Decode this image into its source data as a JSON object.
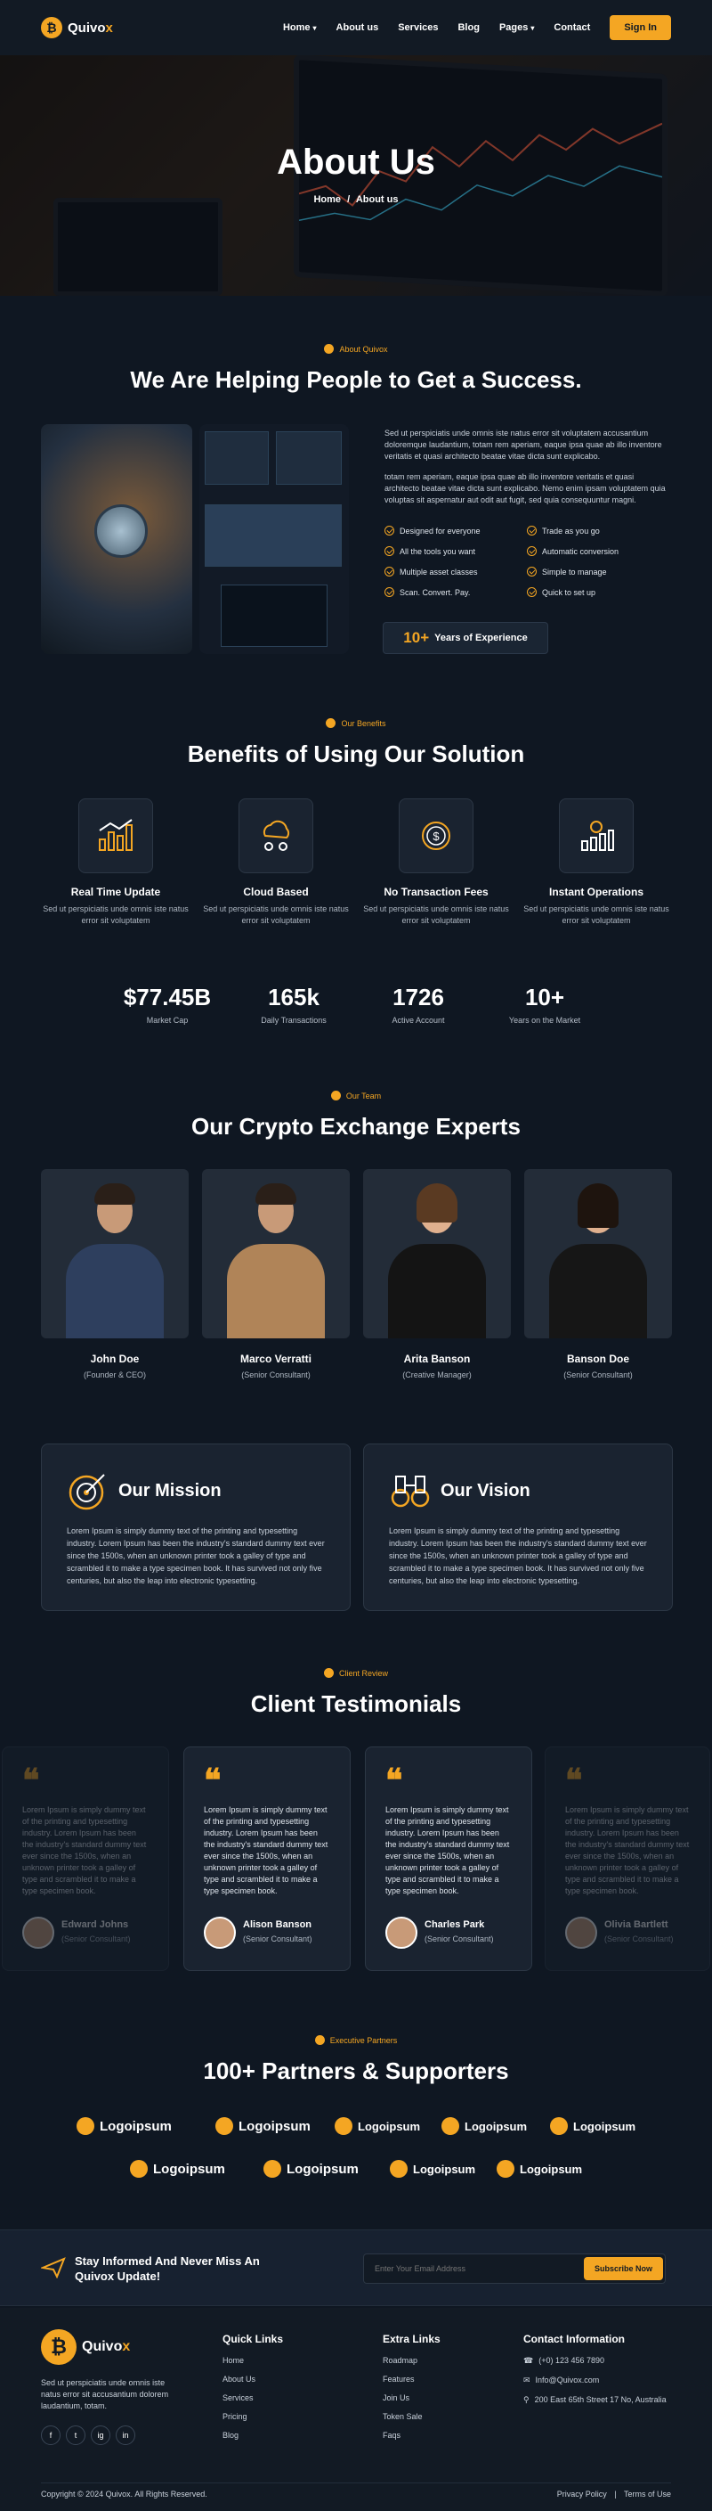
{
  "nav": {
    "brand_prefix": "Quivo",
    "brand_accent": "x",
    "logo_letter": "₿",
    "items": [
      "Home",
      "About us",
      "Services",
      "Blog",
      "Pages",
      "Contact"
    ],
    "signin": "Sign In"
  },
  "hero": {
    "title": "About Us",
    "crumb_home": "Home",
    "crumb_sep": "/",
    "crumb_current": "About us"
  },
  "about": {
    "tag": "About Quivox",
    "title": "We Are Helping People to Get a Success.",
    "para1": "Sed ut perspiciatis unde omnis iste natus error sit voluptatem accusantium doloremque laudantium, totam rem aperiam, eaque ipsa quae ab illo inventore veritatis et quasi architecto beatae vitae dicta sunt explicabo.",
    "para2": "totam rem aperiam, eaque ipsa quae ab illo inventore veritatis et quasi architecto beatae vitae dicta sunt explicabo. Nemo enim ipsam voluptatem quia voluptas sit aspernatur aut odit aut fugit, sed quia consequuntur magni.",
    "checks": [
      "Designed for everyone",
      "Trade as you go",
      "All the tools you want",
      "Automatic conversion",
      "Multiple asset classes",
      "Simple to manage",
      "Scan. Convert. Pay.",
      "Quick to set up"
    ],
    "exp_number": "10+",
    "exp_label": "Years of Experience"
  },
  "benefits": {
    "tag": "Our Benefits",
    "title": "Benefits of Using Our Solution",
    "items": [
      {
        "title": "Real Time Update",
        "desc": "Sed ut perspiciatis unde omnis iste natus error sit voluptatem"
      },
      {
        "title": "Cloud Based",
        "desc": "Sed ut perspiciatis unde omnis iste natus error sit voluptatem"
      },
      {
        "title": "No Transaction Fees",
        "desc": "Sed ut perspiciatis unde omnis iste natus error sit voluptatem"
      },
      {
        "title": "Instant Operations",
        "desc": "Sed ut perspiciatis unde omnis iste natus error sit voluptatem"
      }
    ]
  },
  "stats": [
    {
      "value": "$77.45B",
      "label": "Market Cap"
    },
    {
      "value": "165k",
      "label": "Daily Transactions"
    },
    {
      "value": "1726",
      "label": "Active Account"
    },
    {
      "value": "10+",
      "label": "Years on the Market"
    }
  ],
  "team": {
    "tag": "Our Team",
    "title": "Our Crypto Exchange Experts",
    "members": [
      {
        "name": "John Doe",
        "role": "(Founder & CEO)"
      },
      {
        "name": "Marco Verratti",
        "role": "(Senior Consultant)"
      },
      {
        "name": "Arita Banson",
        "role": "(Creative Manager)"
      },
      {
        "name": "Banson Doe",
        "role": "(Senior Consultant)"
      }
    ]
  },
  "mission": {
    "title": "Our Mission",
    "text": "Lorem Ipsum is simply dummy text of the printing and typesetting industry. Lorem Ipsum has been the industry's standard dummy text ever since the 1500s, when an unknown printer took a galley of type and scrambled it to make a type specimen book. It has survived not only five centuries, but also the leap into electronic typesetting."
  },
  "vision": {
    "title": "Our Vision",
    "text": "Lorem Ipsum is simply dummy text of the printing and typesetting industry. Lorem Ipsum has been the industry's standard dummy text ever since the 1500s, when an unknown printer took a galley of type and scrambled it to make a type specimen book. It has survived not only five centuries, but also the leap into electronic typesetting."
  },
  "testimonials": {
    "tag": "Client Review",
    "title": "Client Testimonials",
    "quote_mark": "❝",
    "text": "Lorem Ipsum is simply dummy text of the printing and typesetting industry. Lorem Ipsum has been the industry's standard dummy text ever since the 1500s, when an unknown printer took a galley of type and scrambled it to make a type specimen book.",
    "items": [
      {
        "name": "Edward Johns",
        "role": "(Senior Consultant)"
      },
      {
        "name": "Alison Banson",
        "role": "(Senior Consultant)"
      },
      {
        "name": "Charles Park",
        "role": "(Senior Consultant)"
      },
      {
        "name": "Olivia Bartlett",
        "role": "(Senior Consultant)"
      }
    ]
  },
  "partners": {
    "tag": "Executive Partners",
    "title": "100+ Partners & Supporters",
    "logo_text": "Logoipsum"
  },
  "newsletter": {
    "title": "Stay Informed And Never Miss An Quivox Update!",
    "placeholder": "Enter Your Email Address",
    "button": "Subscribe Now"
  },
  "footer": {
    "about": "Sed ut perspiciatis unde omnis iste natus error sit accusantium dolorem laudantium, totam.",
    "quick_title": "Quick Links",
    "quick": [
      "Home",
      "About Us",
      "Services",
      "Pricing",
      "Blog"
    ],
    "extra_title": "Extra Links",
    "extra": [
      "Roadmap",
      "Features",
      "Join Us",
      "Token Sale",
      "Faqs"
    ],
    "contact_title": "Contact Information",
    "phone": "(+0) 123 456 7890",
    "email": "Info@Quivox.com",
    "address": "200 East 65th Street 17 No, Australia",
    "social": [
      "f",
      "t",
      "ig",
      "in"
    ],
    "copyright": "Copyright © 2024 Quivox. All Rights Reserved.",
    "privacy": "Privacy Policy",
    "sep": "|",
    "terms": "Terms of Use"
  },
  "colors": {
    "accent": "#f4a623",
    "background": "#0f1722",
    "card": "#1a2330"
  }
}
